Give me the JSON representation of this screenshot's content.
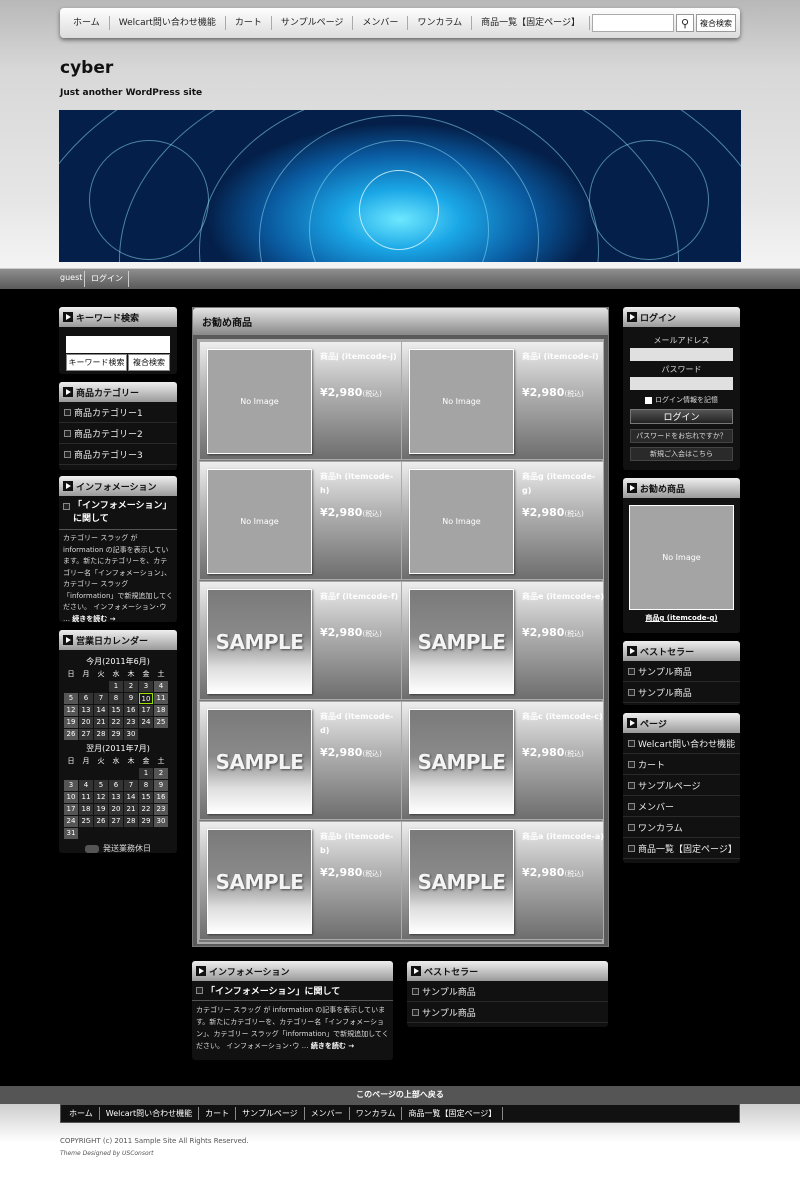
{
  "top_nav": {
    "items": [
      "ホーム",
      "Welcart問い合わせ機能",
      "カート",
      "サンプルページ",
      "メンバー",
      "ワンカラム",
      "商品一覧【固定ページ】"
    ],
    "search_button": "検",
    "advanced_search": "複合検索"
  },
  "site": {
    "name": "cyber",
    "tagline": "Just another WordPress site"
  },
  "sub_bar": {
    "user": "guest",
    "login": "ログイン"
  },
  "left": {
    "keyword": {
      "title": "キーワード検索",
      "search": "キーワード検索",
      "advanced": "複合検索"
    },
    "categories": {
      "title": "商品カテゴリー",
      "items": [
        "商品カテゴリー1",
        "商品カテゴリー2",
        "商品カテゴリー3"
      ]
    },
    "info": {
      "title": "インフォメーション",
      "post_title": "「インフォメーション」に関して",
      "body": "カテゴリー スラッグ が information の記事を表示しています。新たにカテゴリーを、カテゴリー名「インフォメーション」、カテゴリー スラッグ「information」で新規追加してください。 インフォメーション･ウ …",
      "more": "続きを読む →"
    },
    "calendar": {
      "title": "営業日カレンダー",
      "month1": "今月(2011年6月)",
      "month2": "翌月(2011年7月)",
      "weekdays": [
        "日",
        "月",
        "火",
        "水",
        "木",
        "金",
        "土"
      ],
      "legend": "発送業務休日"
    }
  },
  "main": {
    "title": "お勧め商品",
    "tax": "(税込)",
    "products": [
      {
        "name": "商品j (itemcode-j)",
        "price": "¥2,980",
        "image": "No Image"
      },
      {
        "name": "商品i (itemcode-i)",
        "price": "¥2,980",
        "image": "No Image"
      },
      {
        "name": "商品h (itemcode-h)",
        "price": "¥2,980",
        "image": "No Image"
      },
      {
        "name": "商品g (itemcode-g)",
        "price": "¥2,980",
        "image": "No Image"
      },
      {
        "name": "商品f (itemcode-f)",
        "price": "¥2,980",
        "image": "SAMPLE"
      },
      {
        "name": "商品e (itemcode-e)",
        "price": "¥2,980",
        "image": "SAMPLE"
      },
      {
        "name": "商品d (itemcode-d)",
        "price": "¥2,980",
        "image": "SAMPLE"
      },
      {
        "name": "商品c (itemcode-c)",
        "price": "¥2,980",
        "image": "SAMPLE"
      },
      {
        "name": "商品b (itemcode-b)",
        "price": "¥2,980",
        "image": "SAMPLE"
      },
      {
        "name": "商品a (itemcode-a)",
        "price": "¥2,980",
        "image": "SAMPLE"
      }
    ]
  },
  "bottom": {
    "info": {
      "title": "インフォメーション",
      "post_title": "「インフォメーション」に関して",
      "body": "カテゴリー スラッグ が information の記事を表示しています。新たにカテゴリーを、カテゴリー名「インフォメーション」、カテゴリー スラッグ「information」で新規追加してください。 インフォメーション･ウ …",
      "more": "続きを読む →"
    },
    "best": {
      "title": "ベストセラー",
      "items": [
        "サンプル商品",
        "サンプル商品"
      ]
    }
  },
  "right": {
    "login": {
      "title": "ログイン",
      "email_label": "メールアドレス",
      "password_label": "パスワード",
      "remember": "ログイン情報を記憶",
      "button": "ログイン",
      "forgot": "パスワードをお忘れですか？",
      "register": "新規ご入会はこちら"
    },
    "recommend": {
      "title": "お勧め商品",
      "image": "No Image",
      "item": "商品g (itemcode-g)"
    },
    "best": {
      "title": "ベストセラー",
      "items": [
        "サンプル商品",
        "サンプル商品"
      ]
    },
    "pages": {
      "title": "ページ",
      "items": [
        "Welcart問い合わせ機能",
        "カート",
        "サンプルページ",
        "メンバー",
        "ワンカラム",
        "商品一覧【固定ページ】"
      ]
    }
  },
  "footer": {
    "back_to_top": "このページの上部へ戻る",
    "nav": [
      "ホーム",
      "Welcart問い合わせ機能",
      "カート",
      "サンプルページ",
      "メンバー",
      "ワンカラム",
      "商品一覧【固定ページ】"
    ],
    "copyright": "COPYRIGHT (c) 2011 Sample Site All Rights Reserved.",
    "designed": "Theme Designed by USConsort"
  },
  "colors": {
    "today_border": "#9be000",
    "panel": "#111111",
    "grid_bg": "#777777"
  }
}
